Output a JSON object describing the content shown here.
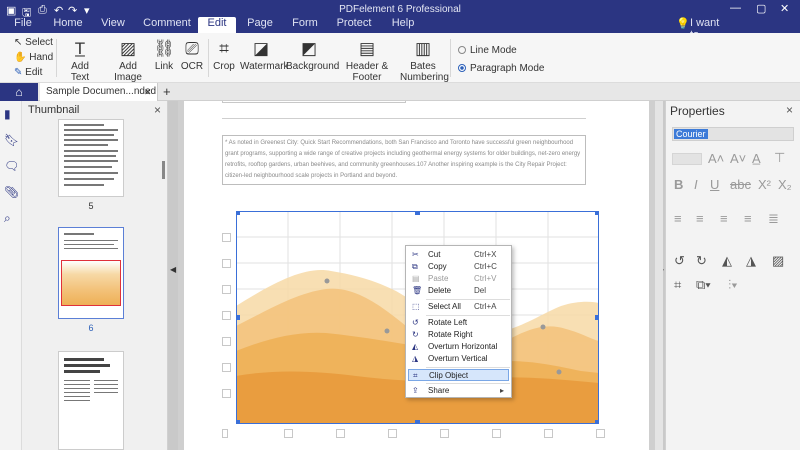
{
  "app": {
    "title": "PDFelement 6 Professional",
    "window_controls": [
      "—",
      "▢",
      "✕"
    ]
  },
  "menu": {
    "items": [
      "File",
      "Home",
      "View",
      "Comment",
      "Edit",
      "Page",
      "Form",
      "Protect",
      "Help"
    ],
    "active": "Edit",
    "iwant": "I want to..."
  },
  "ribbon": {
    "select_items": [
      "Select",
      "Hand",
      "Edit"
    ],
    "tools": [
      "Add Text",
      "Add Image",
      "Link",
      "OCR",
      "Crop",
      "Watermark",
      "Background",
      "Header & Footer",
      "Bates Numbering"
    ],
    "modes": [
      "Line Mode",
      "Paragraph Mode"
    ],
    "selected_mode": "Paragraph Mode"
  },
  "tabs": {
    "document": "Sample Documen...nded",
    "add": "+"
  },
  "thumbnail_panel": {
    "title": "Thumbnail",
    "close": "×",
    "pages": [
      "5",
      "6"
    ]
  },
  "document": {
    "paragraph": "* As noted in Greenest City: Quick Start Recommendations, both San Francisco and Toronto have successful green neighbourhood grant programs, supporting a wide range of creative projects including geothermal energy systems for older buildings, net-zero energy retrofits, rooftop gardens, urban beehives, and community greenhouses.107 Another inspiring example is the City Repair Project: citizen-led neighbourhood scale projects in Portland and beyond.",
    "chart_colors": [
      "#f7d9a6",
      "#f3c27a",
      "#eeb056",
      "#e89a3c"
    ]
  },
  "properties_panel": {
    "title": "Properties",
    "close": "×",
    "font": "Courier"
  },
  "context_menu": {
    "items": [
      {
        "label": "Cut",
        "shortcut": "Ctrl+X",
        "icon": "scissors-icon",
        "disabled": false
      },
      {
        "label": "Copy",
        "shortcut": "Ctrl+C",
        "icon": "copy-icon",
        "disabled": false
      },
      {
        "label": "Paste",
        "shortcut": "Ctrl+V",
        "icon": "paste-icon",
        "disabled": true
      },
      {
        "label": "Delete",
        "shortcut": "Del",
        "icon": "trash-icon",
        "disabled": false
      },
      {
        "label": "Select All",
        "shortcut": "Ctrl+A",
        "icon": "select-all-icon",
        "disabled": false
      },
      {
        "label": "Rotate Left",
        "shortcut": "",
        "icon": "rotate-left-icon",
        "disabled": false
      },
      {
        "label": "Rotate Right",
        "shortcut": "",
        "icon": "rotate-right-icon",
        "disabled": false
      },
      {
        "label": "Overturn Horizontal",
        "shortcut": "",
        "icon": "flip-horizontal-icon",
        "disabled": false
      },
      {
        "label": "Overturn Vertical",
        "shortcut": "",
        "icon": "flip-vertical-icon",
        "disabled": false
      },
      {
        "label": "Clip Object",
        "shortcut": "",
        "icon": "clip-icon",
        "disabled": false
      },
      {
        "label": "Share",
        "shortcut": "▸",
        "icon": "share-icon",
        "disabled": false
      }
    ],
    "highlighted": "Clip Object"
  }
}
